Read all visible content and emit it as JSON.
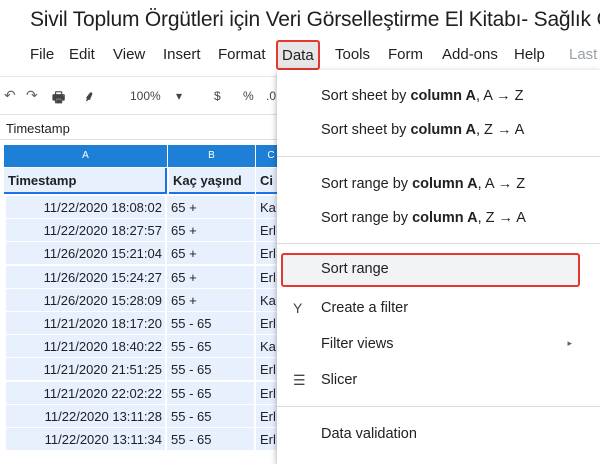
{
  "doc": {
    "title": "Sivil Toplum Örgütleri için Veri Görselleştirme El Kitabı- Sağlık Ça"
  },
  "menubar": {
    "items": [
      "File",
      "Edit",
      "View",
      "Insert",
      "Format",
      "Data",
      "Tools",
      "Form",
      "Add-ons",
      "Help"
    ],
    "last_edit": "Last"
  },
  "toolbar": {
    "undo": "↶",
    "redo": "↷",
    "print": "🖶",
    "paint_format": "⸙",
    "zoom": "100%",
    "zoom_caret": "▾",
    "currency": "$",
    "percent": "%",
    "decimal": ".0"
  },
  "formula_bar": {
    "value": "Timestamp"
  },
  "sheet": {
    "col_headers": [
      "A",
      "B",
      "C"
    ],
    "header_row": [
      "Timestamp",
      "Kaç yaşınd",
      "Ci"
    ],
    "rows": [
      [
        "11/22/2020 18:08:02",
        "65 +",
        "Ka"
      ],
      [
        "11/22/2020 18:27:57",
        "65 +",
        "Erl"
      ],
      [
        "11/26/2020 15:21:04",
        "65 +",
        "Erl"
      ],
      [
        "11/26/2020 15:24:27",
        "65 +",
        "Erl"
      ],
      [
        "11/26/2020 15:28:09",
        "65 +",
        "Ka"
      ],
      [
        "11/21/2020 18:17:20",
        "55 - 65",
        "Erl"
      ],
      [
        "11/21/2020 18:40:22",
        "55 - 65",
        "Ka"
      ],
      [
        "11/21/2020 21:51:25",
        "55 - 65",
        "Erl"
      ],
      [
        "11/21/2020 22:02:22",
        "55 - 65",
        "Erl"
      ],
      [
        "11/22/2020 13:11:28",
        "55 - 65",
        "Erl"
      ],
      [
        "11/22/2020 13:11:34",
        "55 - 65",
        "Erl"
      ]
    ]
  },
  "data_menu": {
    "sort_sheet_prefix": "Sort sheet by ",
    "sort_range_prefix": "Sort range by ",
    "column": "column A",
    "az": ", A → Z",
    "za": ", Z → A",
    "sort_range": "Sort range",
    "create_filter": "Create a filter",
    "filter_views": "Filter views",
    "slicer": "Slicer",
    "data_validation": "Data validation",
    "filter_icon": "filter-icon",
    "slicer_icon": "slicer-icon",
    "submenu_arrow": "▸",
    "filter_glyph": "Y",
    "slicer_glyph": "☰"
  }
}
